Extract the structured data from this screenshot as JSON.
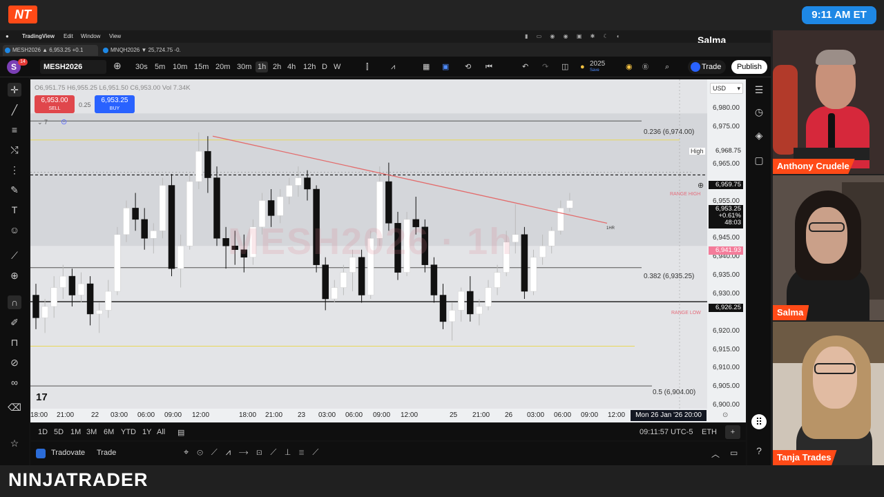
{
  "broadcast": {
    "logo_text": "NT",
    "clock": "9:11 AM ET",
    "brand": "NINJATRADER",
    "speaker_badge": "Salma"
  },
  "mac_menu": [
    "TradingView",
    "Edit",
    "Window",
    "View"
  ],
  "browser_tabs": [
    {
      "label": "MESH2026 ▲ 6,953.25 +0.1"
    },
    {
      "label": "MNQH2026 ▼ 25,724.75 -0."
    }
  ],
  "toolbar": {
    "avatar": "S",
    "notifications": "14",
    "symbol": "MESH2026",
    "intervals": [
      "30s",
      "5m",
      "10m",
      "15m",
      "20m",
      "30m",
      "1h",
      "2h",
      "4h",
      "12h",
      "D",
      "W"
    ],
    "selected_interval": "1h",
    "year_label": "2025",
    "year_sub": "Save",
    "trade_label": "Trade",
    "publish_label": "Publish"
  },
  "ohlc": {
    "o": "O6,951.75",
    "h": "H6,955.25",
    "l": "L6,951.50",
    "c": "C6,953.00",
    "vol": "Vol 7.34K"
  },
  "order_panel": {
    "sell_price": "6,953.00",
    "sell_label": "SELL",
    "spread": "0.25",
    "buy_price": "6,953.25",
    "buy_label": "BUY",
    "indicator_count": "7"
  },
  "watermark": "MESH2026 · 1h",
  "currency": "USD",
  "fib_levels": [
    {
      "label": "0.236 (6,974.00)"
    },
    {
      "label": "0.382 (6,935.25)"
    },
    {
      "label": "0.5 (6,904.00)"
    }
  ],
  "range_labels": {
    "high": "RANGE HIGH",
    "low": "RANGE LOW"
  },
  "trend_label": "1HR",
  "price_axis_labels": [
    "6,980.00",
    "6,975.00",
    "6,965.00",
    "6,955.00",
    "6,945.00",
    "6,940.00",
    "6,935.00",
    "6,930.00",
    "6,920.00",
    "6,915.00",
    "6,910.00",
    "6,905.00",
    "6,900.00"
  ],
  "price_tags": {
    "high_label": "High",
    "high_value": "6,968.75",
    "line_value": "6,959.75",
    "current_value": "6,953.25",
    "current_change": "+0.61%",
    "countdown": "48:03",
    "pink_value": "6,941.93",
    "range_low_value": "6,926.25"
  },
  "time_axis_labels": [
    "18:00",
    "21:00",
    "22",
    "03:00",
    "06:00",
    "09:00",
    "12:00",
    "18:00",
    "21:00",
    "23",
    "03:00",
    "06:00",
    "09:00",
    "12:00",
    "25",
    "21:00",
    "26",
    "03:00",
    "06:00",
    "09:00",
    "12:00"
  ],
  "crosshair_time": "Mon 26 Jan '26  20:00",
  "bottom_ranges": [
    "1D",
    "5D",
    "1M",
    "3M",
    "6M",
    "YTD",
    "1Y",
    "All"
  ],
  "bottom_status": {
    "time": "09:11:57 UTC-5",
    "session": "ETH"
  },
  "tradovate": {
    "broker": "Tradovate",
    "trade": "Trade"
  },
  "participants": [
    {
      "name": "Anthony Crudele"
    },
    {
      "name": "Salma"
    },
    {
      "name": "Tanja Trades"
    }
  ],
  "chart_data": {
    "type": "candlestick",
    "ylim": [
      6898,
      6985
    ],
    "candles": [
      [
        6928,
        6931,
        6919,
        6922
      ],
      [
        6922,
        6927,
        6918,
        6925
      ],
      [
        6925,
        6933,
        6922,
        6930
      ],
      [
        6930,
        6936,
        6927,
        6933
      ],
      [
        6933,
        6935,
        6925,
        6928
      ],
      [
        6928,
        6934,
        6926,
        6931
      ],
      [
        6931,
        6933,
        6920,
        6923
      ],
      [
        6923,
        6926,
        6918,
        6924
      ],
      [
        6924,
        6932,
        6922,
        6929
      ],
      [
        6929,
        6946,
        6928,
        6944
      ],
      [
        6944,
        6953,
        6942,
        6951
      ],
      [
        6951,
        6955,
        6945,
        6948
      ],
      [
        6948,
        6951,
        6940,
        6943
      ],
      [
        6943,
        6947,
        6939,
        6945
      ],
      [
        6945,
        6959,
        6943,
        6957
      ],
      [
        6957,
        6960,
        6933,
        6935
      ],
      [
        6935,
        6944,
        6930,
        6941
      ],
      [
        6941,
        6960,
        6940,
        6958
      ],
      [
        6958,
        6971,
        6956,
        6966
      ],
      [
        6966,
        6970,
        6955,
        6959
      ],
      [
        6959,
        6962,
        6941,
        6943
      ],
      [
        6943,
        6946,
        6935,
        6941
      ],
      [
        6941,
        6945,
        6936,
        6940
      ],
      [
        6940,
        6944,
        6934,
        6938
      ],
      [
        6938,
        6948,
        6936,
        6946
      ],
      [
        6946,
        6955,
        6944,
        6953
      ],
      [
        6953,
        6956,
        6946,
        6949
      ],
      [
        6949,
        6956,
        6947,
        6954
      ],
      [
        6954,
        6959,
        6952,
        6957
      ],
      [
        6957,
        6962,
        6954,
        6959
      ],
      [
        6959,
        6961,
        6953,
        6956
      ],
      [
        6956,
        6957,
        6934,
        6936
      ],
      [
        6936,
        6938,
        6924,
        6927
      ],
      [
        6927,
        6932,
        6926,
        6930
      ],
      [
        6930,
        6936,
        6928,
        6934
      ],
      [
        6934,
        6940,
        6929,
        6938
      ],
      [
        6938,
        6940,
        6926,
        6928
      ],
      [
        6928,
        6945,
        6927,
        6943
      ],
      [
        6943,
        6962,
        6941,
        6958
      ],
      [
        6958,
        6963,
        6945,
        6947
      ],
      [
        6947,
        6950,
        6932,
        6934
      ],
      [
        6934,
        6950,
        6933,
        6948
      ],
      [
        6948,
        6954,
        6944,
        6946
      ],
      [
        6946,
        6948,
        6934,
        6936
      ],
      [
        6936,
        6938,
        6926,
        6928
      ],
      [
        6928,
        6931,
        6919,
        6921
      ],
      [
        6921,
        6926,
        6916,
        6924
      ],
      [
        6924,
        6930,
        6921,
        6929
      ],
      [
        6929,
        6933,
        6921,
        6923
      ],
      [
        6923,
        6927,
        6920,
        6925
      ],
      [
        6925,
        6932,
        6924,
        6930
      ],
      [
        6930,
        6936,
        6928,
        6934
      ],
      [
        6934,
        6945,
        6933,
        6942
      ],
      [
        6942,
        6952,
        6939,
        6944
      ],
      [
        6944,
        6946,
        6927,
        6929
      ],
      [
        6929,
        6940,
        6928,
        6938
      ],
      [
        6938,
        6944,
        6936,
        6941
      ],
      [
        6941,
        6946,
        6939,
        6945
      ],
      [
        6945,
        6953,
        6944,
        6951
      ],
      [
        6951,
        6955,
        6950,
        6953
      ]
    ]
  }
}
